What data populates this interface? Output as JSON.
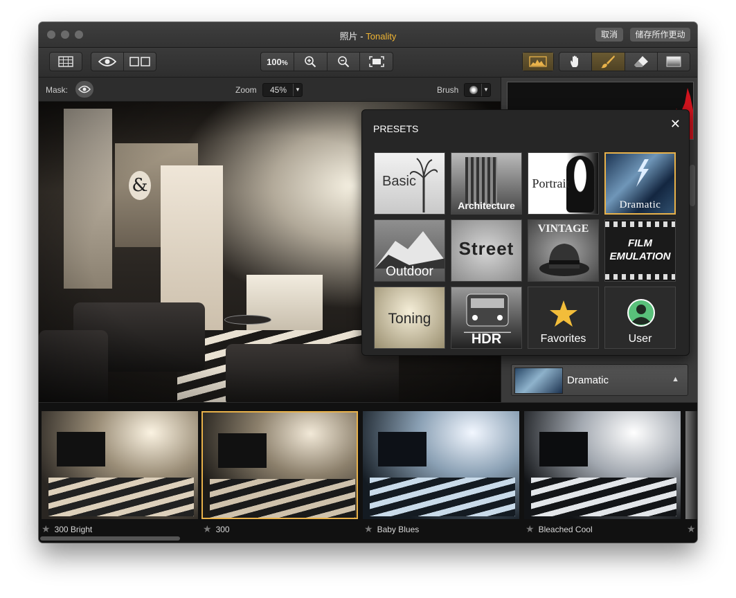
{
  "window": {
    "title_doc": "照片",
    "title_sep": " - ",
    "title_app": "Tonality",
    "cancel_label": "取消",
    "save_label": "储存所作更动"
  },
  "toolbar": {
    "zoom_value": "100",
    "zoom_unit": "%"
  },
  "options": {
    "mask_label": "Mask:",
    "zoom_label": "Zoom",
    "zoom_value": "45%",
    "brush_label": "Brush"
  },
  "presets_popup": {
    "title": "PRESETS",
    "close_icon": "close-icon",
    "tiles": [
      {
        "label": "Basic"
      },
      {
        "label": "Architecture"
      },
      {
        "label": "Portrait"
      },
      {
        "label": "Dramatic"
      },
      {
        "label": "Outdoor"
      },
      {
        "label": "Street"
      },
      {
        "label": "VINTAGE"
      },
      {
        "label": "FILM EMULATION"
      },
      {
        "label": "Toning"
      },
      {
        "label": "HDR"
      },
      {
        "label": "Favorites"
      },
      {
        "label": "User"
      }
    ],
    "selected": "Dramatic"
  },
  "preset_selector": {
    "current": "Dramatic"
  },
  "filmstrip": {
    "items": [
      {
        "label": "300 Bright"
      },
      {
        "label": "300"
      },
      {
        "label": "Baby Blues"
      },
      {
        "label": "Bleached Cool"
      }
    ],
    "selected": "300"
  },
  "colors": {
    "accent": "#e9b24a",
    "title_app": "#f0b533",
    "histogram_red": "#d0141e"
  }
}
